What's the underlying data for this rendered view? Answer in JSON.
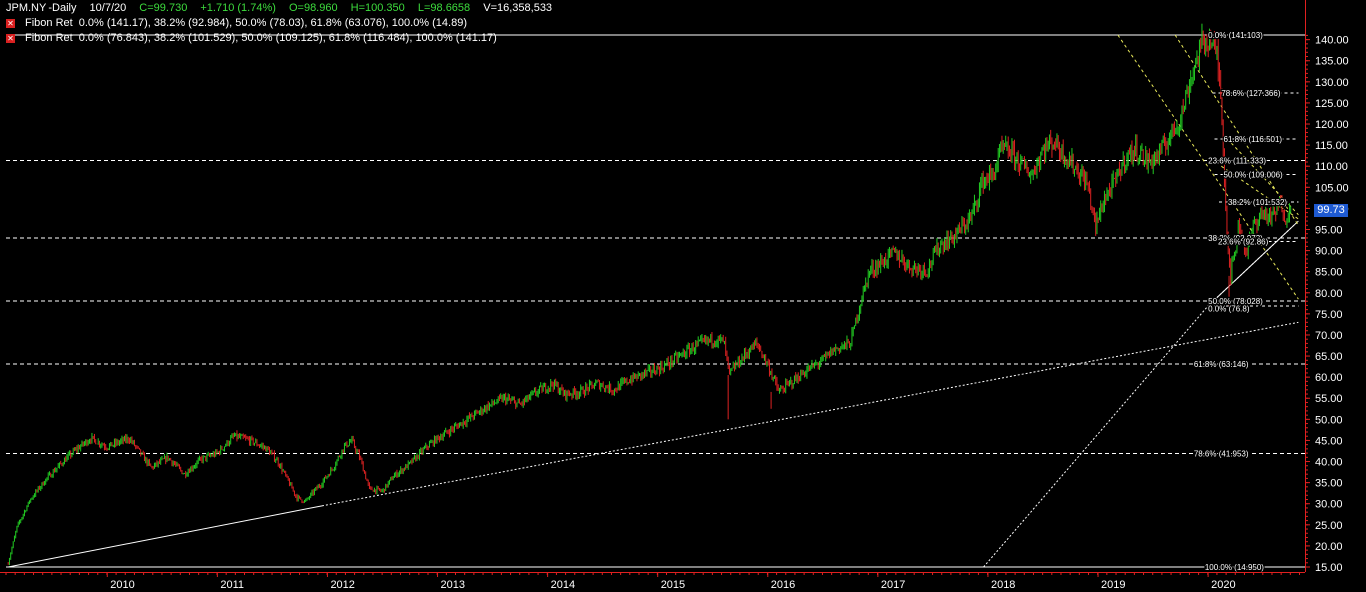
{
  "header": {
    "symbol": "JPM.NY",
    "interval": "-Daily",
    "date": "10/7/20",
    "close": "C=99.730",
    "change": "+1.710 (1.74%)",
    "open": "O=98.960",
    "high": "H=100.350",
    "low": "L=98.6658",
    "volume": "V=16,358,533"
  },
  "studies": [
    {
      "name": "Fibon Ret",
      "text": "0.0% (141.17), 38.2% (92.984), 50.0% (78.03), 61.8% (63.076), 100.0% (14.89)"
    },
    {
      "name": "Fibon Ret",
      "text": "0.0% (76.843), 38.2% (101.529), 50.0% (109.125), 61.8% (116.484), 100.0% (141.17)"
    }
  ],
  "colors": {
    "background": "#000000",
    "up": "#22cc22",
    "down": "#dd2222",
    "axis": "#e02020",
    "grid": "#ffffff",
    "fib_small": "#ffffff",
    "fan": "#e8e85a",
    "price_badge": "#1e5ad2",
    "header_values": "#3ddc3d"
  },
  "price_badge": "99.73",
  "chart_data": {
    "type": "candlestick",
    "title": "",
    "xlabel": "",
    "ylabel": "",
    "ylim": [
      15.0,
      141.1
    ],
    "y_ticks": [
      15,
      20,
      25,
      30,
      35,
      40,
      45,
      50,
      55,
      60,
      65,
      70,
      75,
      80,
      85,
      90,
      95,
      100,
      105,
      110,
      115,
      120,
      125,
      130,
      135,
      140
    ],
    "y_tick_labels": [
      "15.00",
      "20.00",
      "25.00",
      "30.00",
      "35.00",
      "40.00",
      "45.00",
      "50.00",
      "55.00",
      "60.00",
      "65.00",
      "70.00",
      "75.00",
      "80.00",
      "85.00",
      "90.00",
      "95.00",
      "100.00",
      "105.00",
      "110.00",
      "115.00",
      "120.00",
      "125.00",
      "130.00",
      "135.00",
      "140.00"
    ],
    "x_range": [
      2009.08,
      2020.88
    ],
    "x_ticks": [
      2010,
      2011,
      2012,
      2013,
      2014,
      2015,
      2016,
      2017,
      2018,
      2019,
      2020
    ],
    "x_tick_labels": [
      "2010",
      "2011",
      "2012",
      "2013",
      "2014",
      "2015",
      "2016",
      "2017",
      "2018",
      "2019",
      "2020"
    ],
    "price_path": {
      "x": [
        2009.1,
        2009.18,
        2009.3,
        2009.45,
        2009.58,
        2009.7,
        2009.85,
        2010.0,
        2010.1,
        2010.2,
        2010.3,
        2010.4,
        2010.55,
        2010.7,
        2010.85,
        2011.0,
        2011.15,
        2011.3,
        2011.45,
        2011.55,
        2011.65,
        2011.72,
        2011.8,
        2011.88,
        2011.95,
        2012.05,
        2012.15,
        2012.22,
        2012.3,
        2012.38,
        2012.5,
        2012.6,
        2012.75,
        2012.9,
        2013.0,
        2013.15,
        2013.3,
        2013.45,
        2013.6,
        2013.75,
        2013.9,
        2014.05,
        2014.15,
        2014.3,
        2014.45,
        2014.6,
        2014.75,
        2014.9,
        2015.05,
        2015.2,
        2015.35,
        2015.5,
        2015.6,
        2015.65,
        2015.7,
        2015.8,
        2015.9,
        2016.0,
        2016.1,
        2016.2,
        2016.35,
        2016.5,
        2016.6,
        2016.75,
        2016.83,
        2016.92,
        2017.0,
        2017.15,
        2017.3,
        2017.45,
        2017.55,
        2017.7,
        2017.85,
        2017.95,
        2018.05,
        2018.12,
        2018.2,
        2018.3,
        2018.4,
        2018.5,
        2018.6,
        2018.7,
        2018.8,
        2018.9,
        2018.98,
        2019.05,
        2019.15,
        2019.25,
        2019.35,
        2019.45,
        2019.55,
        2019.65,
        2019.75,
        2019.85,
        2019.95,
        2020.02,
        2020.08,
        2020.12,
        2020.16,
        2020.2,
        2020.24,
        2020.28,
        2020.35,
        2020.42,
        2020.5,
        2020.58,
        2020.66,
        2020.7,
        2020.76
      ],
      "y": [
        15.9,
        24.5,
        31.0,
        36.0,
        39.5,
        42.5,
        45.5,
        43.5,
        44.5,
        45.5,
        42.0,
        38.5,
        41.0,
        37.0,
        40.5,
        42.0,
        46.0,
        45.0,
        43.0,
        40.0,
        35.0,
        31.5,
        30.5,
        33.0,
        35.0,
        38.5,
        43.5,
        45.0,
        40.5,
        33.5,
        33.0,
        36.5,
        39.5,
        43.5,
        45.5,
        48.0,
        50.5,
        53.0,
        55.0,
        53.5,
        56.5,
        58.5,
        56.0,
        56.5,
        58.5,
        57.0,
        59.5,
        61.0,
        62.5,
        65.0,
        67.5,
        69.0,
        68.5,
        60.5,
        62.5,
        65.5,
        68.0,
        63.0,
        56.5,
        58.5,
        61.5,
        64.0,
        66.5,
        68.0,
        76.5,
        85.0,
        86.5,
        89.5,
        86.0,
        85.5,
        91.0,
        93.5,
        98.0,
        106.5,
        108.0,
        114.0,
        113.5,
        110.5,
        108.0,
        114.0,
        116.0,
        112.5,
        109.5,
        106.0,
        95.5,
        102.0,
        106.0,
        112.0,
        114.0,
        111.0,
        112.5,
        117.0,
        121.5,
        131.5,
        139.5,
        140.0,
        136.5,
        126.0,
        100.0,
        84.0,
        89.0,
        96.5,
        89.5,
        96.5,
        99.0,
        97.5,
        101.5,
        98.0,
        99.73
      ]
    },
    "spikes": [
      {
        "x": 2015.64,
        "low": 50.0
      },
      {
        "x": 2016.03,
        "low": 52.5
      },
      {
        "x": 2020.19,
        "low": 76.9
      }
    ],
    "fib_full": [
      {
        "y": 141.1,
        "style": "solid"
      },
      {
        "y": 111.33,
        "style": "dashed"
      },
      {
        "y": 93.0,
        "style": "dashed"
      },
      {
        "y": 78.03,
        "style": "dashed"
      },
      {
        "y": 63.1,
        "style": "dashed"
      },
      {
        "y": 41.95,
        "style": "dashed"
      },
      {
        "y": 15.0,
        "style": "solid"
      }
    ],
    "fib_labels": [
      {
        "x": 2020.0,
        "y": 141.1,
        "text": "0.0% (141.103)"
      },
      {
        "x": 2020.12,
        "y": 127.37,
        "text": "78.6% (127.366)"
      },
      {
        "x": 2020.14,
        "y": 116.5,
        "text": "61.8% (116.501)"
      },
      {
        "x": 2020.0,
        "y": 111.33,
        "text": "23.6% (111.333)"
      },
      {
        "x": 2020.14,
        "y": 108.0,
        "text": "50.0% (109.006)"
      },
      {
        "x": 2020.18,
        "y": 101.5,
        "text": "38.2% (101.532)"
      },
      {
        "x": 2020.0,
        "y": 93.0,
        "text": "38.2% (92.973)"
      },
      {
        "x": 2020.09,
        "y": 92.2,
        "text": "23.6% (92.86)"
      },
      {
        "x": 2020.0,
        "y": 78.03,
        "text": "50.0% (78.028)"
      },
      {
        "x": 2020.0,
        "y": 76.3,
        "text": "0.0% (76.8)"
      },
      {
        "x": 2019.87,
        "y": 63.1,
        "text": "61.8% (63.146)"
      },
      {
        "x": 2019.87,
        "y": 41.95,
        "text": "78.6% (41.953)"
      },
      {
        "x": 2019.97,
        "y": 15.0,
        "text": "100.0% (14.950)"
      }
    ],
    "fib_short_lines": [
      {
        "x1": 2020.04,
        "x2": 2020.82,
        "y": 127.37
      },
      {
        "x1": 2020.06,
        "x2": 2020.82,
        "y": 116.5
      },
      {
        "x1": 2020.06,
        "x2": 2020.82,
        "y": 108.0
      },
      {
        "x1": 2020.1,
        "x2": 2020.82,
        "y": 101.5
      },
      {
        "x1": 2020.06,
        "x2": 2020.82,
        "y": 92.2
      },
      {
        "x1": 2020.0,
        "x2": 2020.82,
        "y": 76.9
      }
    ],
    "trendlines": [
      {
        "x1": 2009.1,
        "y1": 15.0,
        "x2": 2011.95,
        "y2": 29.5,
        "style": "solid",
        "color": "#ffffff"
      },
      {
        "x1": 2011.95,
        "y1": 29.5,
        "x2": 2020.82,
        "y2": 73.0,
        "style": "dotted",
        "color": "#ffffff"
      },
      {
        "x1": 2020.0,
        "y1": 76.9,
        "x2": 2020.82,
        "y2": 97.0,
        "style": "solid",
        "color": "#ffffff"
      },
      {
        "x1": 2017.96,
        "y1": 15.0,
        "x2": 2020.0,
        "y2": 76.9,
        "style": "dotted",
        "color": "#ffffff"
      },
      {
        "x1": 2020.0,
        "y1": 76.9,
        "x2": 2020.82,
        "y2": 97.0,
        "style": "dotted",
        "color": "#ffffff"
      }
    ],
    "fan_lines": [
      {
        "x1": 2019.18,
        "y1": 141.1,
        "x2": 2020.82,
        "y2": 78.5
      },
      {
        "x1": 2019.7,
        "y1": 141.1,
        "x2": 2020.82,
        "y2": 96.0
      },
      {
        "x1": 2020.12,
        "y1": 110.0,
        "x2": 2020.82,
        "y2": 97.5
      },
      {
        "x1": 2020.21,
        "y1": 115.5,
        "x2": 2020.82,
        "y2": 98.5
      }
    ]
  }
}
